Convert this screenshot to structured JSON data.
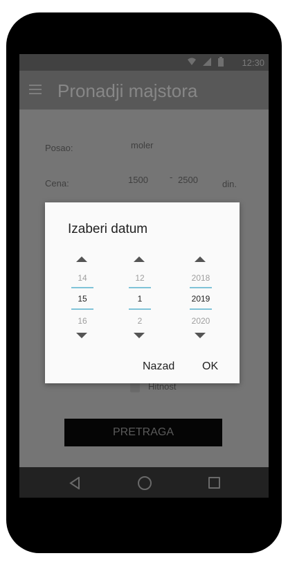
{
  "status_bar": {
    "time": "12:30",
    "icons": [
      "wifi-icon",
      "signal-icon",
      "battery-icon"
    ]
  },
  "app_bar": {
    "menu_icon": "menu-icon",
    "title": "Pronadji majstora"
  },
  "form": {
    "posao_label": "Posao:",
    "posao_value": "moler",
    "cena_label": "Cena:",
    "cena_min": "1500",
    "cena_sep": "-",
    "cena_max": "2500",
    "cena_unit": "din.",
    "hitnost_label": "Hitnost",
    "search_label": "PRETRAGA"
  },
  "dialog": {
    "title": "Izaberi datum",
    "day": {
      "prev": "14",
      "current": "15",
      "next": "16"
    },
    "month": {
      "prev": "12",
      "current": "1",
      "next": "2"
    },
    "year": {
      "prev": "2018",
      "current": "2019",
      "next": "2020"
    },
    "back_label": "Nazad",
    "ok_label": "OK"
  },
  "nav_bar": {
    "items": [
      "back-icon",
      "home-icon",
      "recents-icon"
    ]
  },
  "colors": {
    "overlay": "#757575",
    "app_bar": "#585858",
    "accent_line": "#7fc3d8",
    "dialog_bg": "#fafafa"
  }
}
